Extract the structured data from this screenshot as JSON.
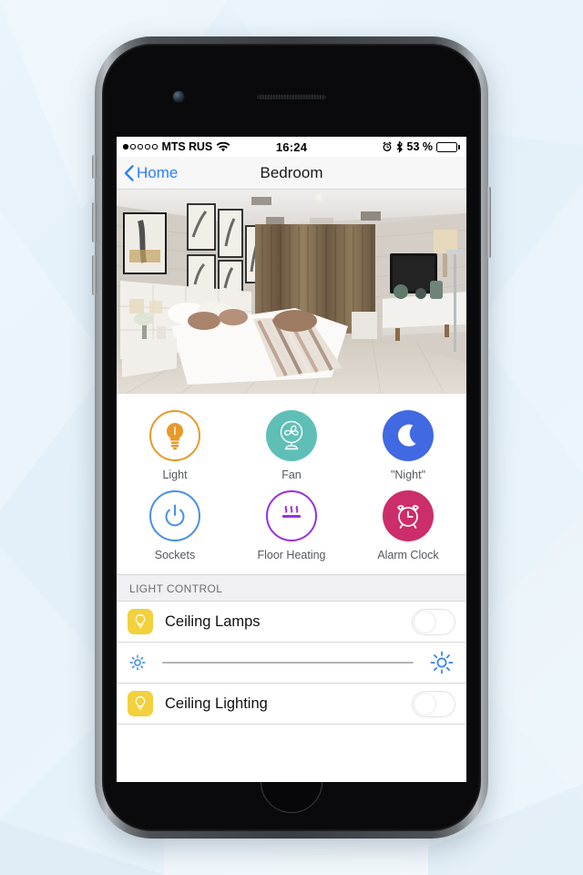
{
  "status_bar": {
    "signal_dots": [
      true,
      false,
      false,
      false,
      false
    ],
    "carrier": "MTS RUS",
    "wifi_icon": "wifi-icon",
    "time": "16:24",
    "alarm_icon": "alarm-icon",
    "bluetooth_icon": "bluetooth-icon",
    "battery_percent": "53 %",
    "battery_level": 53
  },
  "nav": {
    "back_label": "Home",
    "back_icon": "chevron-left-icon",
    "title": "Bedroom"
  },
  "hero": {
    "alt": "bedroom-photo"
  },
  "scenes": [
    {
      "label": "Light",
      "icon": "lightbulb-icon",
      "color": "#e8992a",
      "style": "outline"
    },
    {
      "label": "Fan",
      "icon": "fan-icon",
      "color": "#5fbfb7",
      "style": "filled"
    },
    {
      "label": "\"Night\"",
      "icon": "moon-icon",
      "color": "#4169e1",
      "style": "filled"
    },
    {
      "label": "Sockets",
      "icon": "power-icon",
      "color": "#4a90e2",
      "style": "outline"
    },
    {
      "label": "Floor Heating",
      "icon": "heat-waves-icon",
      "color": "#9b2fe0",
      "style": "outline"
    },
    {
      "label": "Alarm Clock",
      "icon": "alarm-clock-icon",
      "color": "#cc2d6b",
      "style": "filled"
    }
  ],
  "light_control": {
    "section_title": "LIGHT CONTROL",
    "rows": [
      {
        "label": "Ceiling Lamps",
        "icon": "lightbulb-icon",
        "icon_bg": "#f2d13c",
        "toggle_on": false
      },
      {
        "label": "Ceiling Lighting",
        "icon": "lightbulb-icon",
        "icon_bg": "#f2d13c",
        "toggle_on": false
      }
    ],
    "brightness": {
      "low_icon": "brightness-low-icon",
      "high_icon": "brightness-high-icon",
      "value": 0,
      "track_color": "#b5b5b8",
      "icon_color": "#2d7ff9"
    }
  }
}
